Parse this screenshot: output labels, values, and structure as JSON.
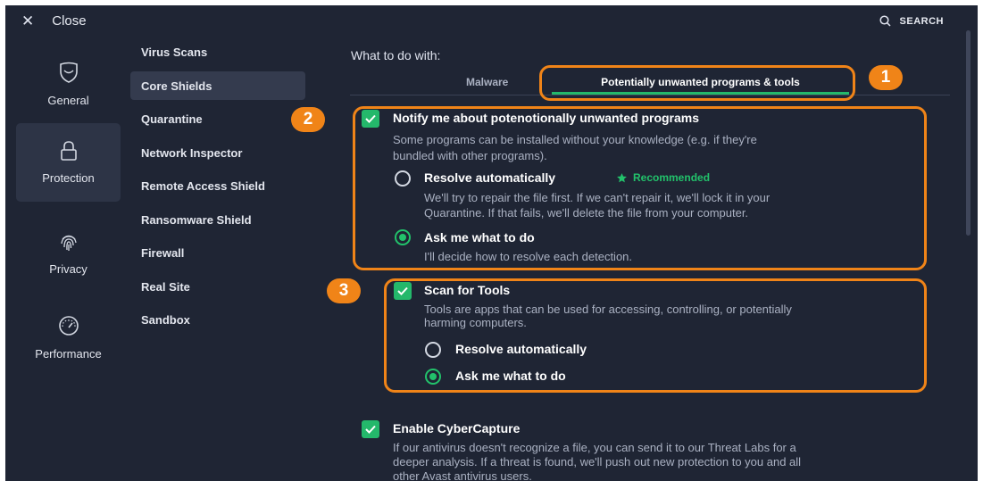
{
  "header": {
    "close_label": "Close",
    "search_label": "SEARCH"
  },
  "nav": {
    "general": "General",
    "protection": "Protection",
    "privacy": "Privacy",
    "performance": "Performance"
  },
  "subnav": [
    "Virus Scans",
    "Core Shields",
    "Quarantine",
    "Network Inspector",
    "Remote Access Shield",
    "Ransomware Shield",
    "Firewall",
    "Real Site",
    "Sandbox"
  ],
  "content": {
    "heading": "What to do with:",
    "tabs": [
      "Malware",
      "Potentially unwanted programs & tools"
    ],
    "pup": {
      "title": "Notify me about potenotionally unwanted programs",
      "desc_line1": "Some programs can be installed without your knowledge (e.g. if they're",
      "desc_line2": "bundled with other programs).",
      "opt1": "Resolve automatically",
      "recommended": "Recommended",
      "opt1_desc_line1": "We'll try to repair the file first. If we can't repair it, we'll lock it in your",
      "opt1_desc_line2": "Quarantine. If that fails, we'll delete the file from your computer.",
      "opt2": "Ask me what to do",
      "opt2_desc": "I'll decide how to resolve each detection."
    },
    "tools": {
      "title": "Scan for Tools",
      "desc_line1": "Tools are apps that can be used for accessing, controlling, or potentially",
      "desc_line2": "harming computers.",
      "opt1": "Resolve automatically",
      "opt2": "Ask me what to do"
    },
    "cyber": {
      "title": "Enable CyberCapture",
      "desc_line1": "If our antivirus doesn't recognize a file, you can send it to our Threat Labs for a",
      "desc_line2": "deeper analysis. If a threat is found, we'll push out new protection to you and all",
      "desc_line3": "other Avast antivirus users."
    }
  },
  "callouts": [
    "1",
    "2",
    "3"
  ],
  "colors": {
    "background": "#1f2534",
    "accent_green": "#24b86b",
    "highlight_orange": "#f08418"
  },
  "icons": [
    "close-icon",
    "search-icon",
    "shield-icon",
    "lock-icon",
    "fingerprint-icon",
    "speedometer-icon",
    "check-icon",
    "star-icon"
  ]
}
